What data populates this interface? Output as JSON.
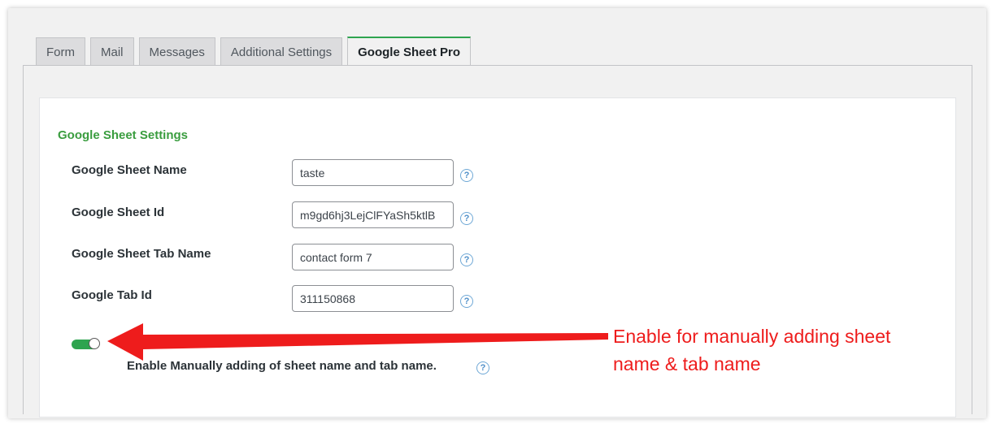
{
  "tabs": [
    {
      "label": "Form",
      "active": false
    },
    {
      "label": "Mail",
      "active": false
    },
    {
      "label": "Messages",
      "active": false
    },
    {
      "label": "Additional Settings",
      "active": false
    },
    {
      "label": "Google Sheet Pro",
      "active": true
    }
  ],
  "section": {
    "title": "Google Sheet Settings",
    "fields": [
      {
        "label": "Google Sheet Name",
        "value": "taste"
      },
      {
        "label": "Google Sheet Id",
        "value": "m9gd6hj3LejClFYaSh5ktlB"
      },
      {
        "label": "Google Sheet Tab Name",
        "value": "contact form 7"
      },
      {
        "label": "Google Tab Id",
        "value": "311150868"
      }
    ],
    "help_glyph": "?",
    "toggle": {
      "label": "Enable Manually adding of sheet name and tab name.",
      "on": true
    }
  },
  "annotation": {
    "line1": "Enable for manually adding sheet",
    "line2": "name & tab name",
    "color": "#ee1c1c"
  },
  "colors": {
    "accent": "#2ea44f",
    "section_title": "#3a9d3f"
  }
}
